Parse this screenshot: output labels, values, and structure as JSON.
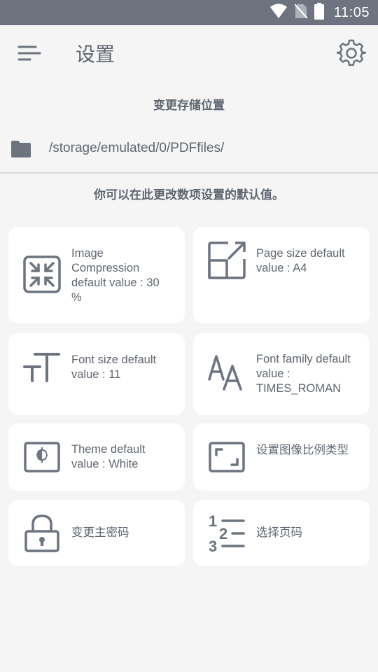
{
  "status_bar": {
    "time": "11:05",
    "icons": [
      "wifi-icon",
      "no-sim-icon",
      "battery-icon"
    ]
  },
  "app_bar": {
    "title": "设置",
    "icons": [
      "hamburger-menu-icon",
      "gear-icon"
    ]
  },
  "storage": {
    "header": "变更存储位置",
    "path": "/storage/emulated/0/PDFfiles/",
    "icon": "folder-icon"
  },
  "defaults_description": "你可以在此更改数项设置的默认值。",
  "cards": [
    {
      "label": "Image Compression default value : 30 %",
      "icon": "compress-icon"
    },
    {
      "label": "Page size default value : A4",
      "icon": "page-size-icon"
    },
    {
      "label": "Font size default value : 11",
      "icon": "font-size-icon"
    },
    {
      "label": "Font family default value : TIMES_ROMAN",
      "icon": "font-family-icon"
    },
    {
      "label": "Theme default value : White",
      "icon": "theme-icon"
    },
    {
      "label": "设置图像比例类型",
      "icon": "aspect-ratio-icon"
    },
    {
      "label": "变更主密码",
      "icon": "lock-icon"
    },
    {
      "label": "选择页码",
      "icon": "numbered-list-icon"
    }
  ],
  "colors": {
    "status_bar": "#6d7480",
    "background": "#f5f5f5",
    "card": "#ffffff",
    "text": "#5f6670",
    "icon": "#6d7480"
  }
}
